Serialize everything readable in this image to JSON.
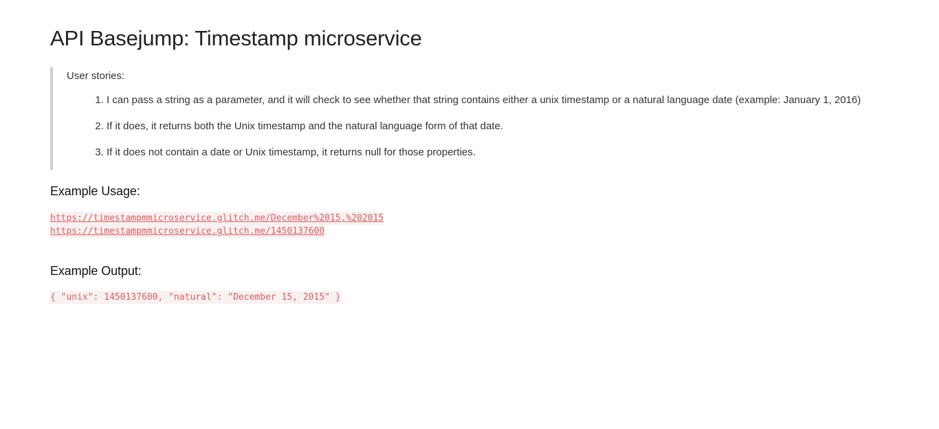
{
  "page": {
    "title": "API Basejump: Timestamp microservice"
  },
  "stories": {
    "heading": "User stories:",
    "items": [
      "I can pass a string as a parameter, and it will check to see whether that string contains either a unix timestamp or a natural language date (example: January 1, 2016)",
      "If it does, it returns both the Unix timestamp and the natural language form of that date.",
      "If it does not contain a date or Unix timestamp, it returns null for those properties."
    ]
  },
  "usage": {
    "heading": "Example Usage:",
    "links": [
      "https://timestampmmicroservice.glitch.me/December%2015,%202015",
      "https://timestampmmicroservice.glitch.me/1450137600"
    ]
  },
  "output": {
    "heading": "Example Output:",
    "code": "{ \"unix\": 1450137600, \"natural\": \"December 15, 2015\" }"
  },
  "colors": {
    "code_text": "#dd5f5f",
    "code_background": "#f8f1f1",
    "quote_border": "#cfcfcf"
  }
}
